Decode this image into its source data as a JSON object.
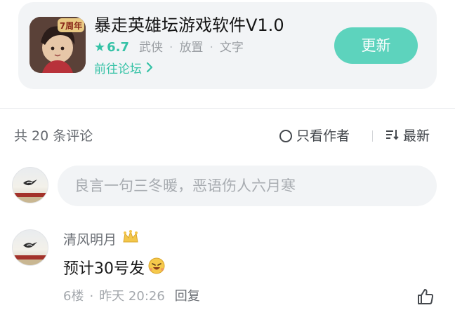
{
  "app": {
    "title": "暴走英雄坛游戏软件V1.0",
    "icon": "app-icon",
    "icon_badge": "7周年",
    "rating": "6.7",
    "tags": [
      "武侠",
      "放置",
      "文字"
    ],
    "forum_link": "前往论坛",
    "update_button": "更新"
  },
  "comments_header": {
    "count_text": "共 20 条评论",
    "only_author": "只看作者",
    "sort": "最新"
  },
  "composer": {
    "placeholder": "良言一句三冬暖，恶语伤人六月寒"
  },
  "comments": [
    {
      "user": "清风明月",
      "text": "预计30号发",
      "floor": "6楼",
      "time": "昨天 20:26",
      "reply": "回复"
    }
  ],
  "colors": {
    "accent": "#35c2a6",
    "button": "#5dd3bd",
    "card_bg": "#f2f4f6"
  }
}
